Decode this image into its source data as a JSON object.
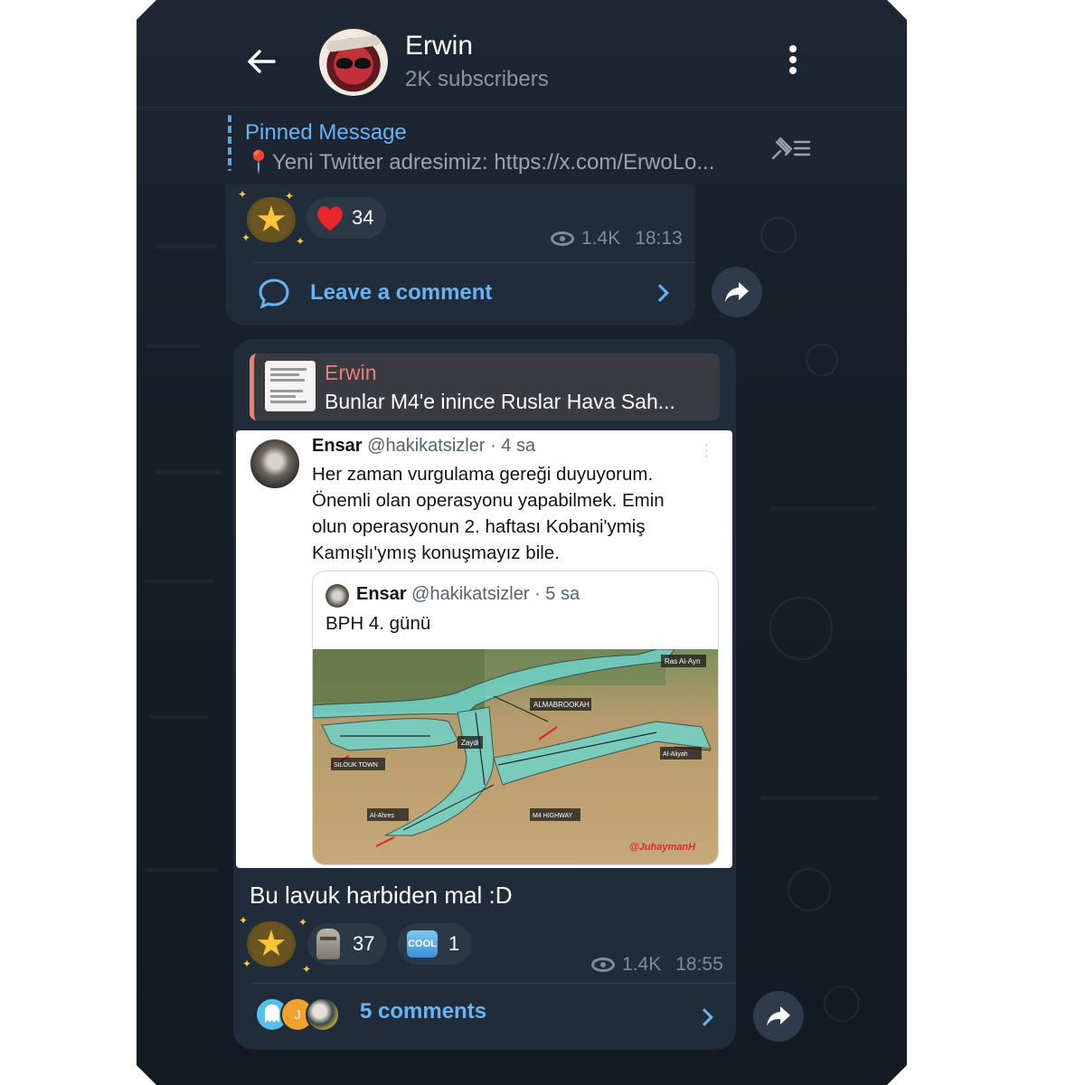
{
  "header": {
    "channel_name": "Erwin",
    "subscribers": "2K subscribers"
  },
  "pinned": {
    "title": "Pinned Message",
    "text": "📍Yeni Twitter adresimiz:  https://x.com/ErwoLo..."
  },
  "message1": {
    "reactions": [
      {
        "icon": "star-icon",
        "count": ""
      },
      {
        "icon": "heart-icon",
        "count": "34"
      }
    ],
    "views": "1.4K",
    "time": "18:13",
    "comment_label": "Leave a comment"
  },
  "message2": {
    "reply": {
      "author": "Erwin",
      "text": "Bunlar M4'e inince Ruslar Hava Sah..."
    },
    "tweet": {
      "author": "Ensar",
      "handle": "@hakikatsizler",
      "age": "· 4 sa",
      "lines": [
        "Her zaman vurgulama gereği duyuyorum.",
        "Önemli olan operasyonu yapabilmek. Emin",
        "olun operasyonun 2. haftası Kobani'ymiş",
        "Kamışlı'ymış konuşmayız bile."
      ],
      "quote": {
        "author": "Ensar",
        "handle": "@hakikatsizler",
        "age": "· 5 sa",
        "text": "BPH 4. günü",
        "map_labels": {
          "ras": "Ras Al-Ayn",
          "almabrookah": "ALMABROOKAH",
          "zaydi": "Zaydi",
          "silouk": "SILOUK TOWN",
          "ahres": "Al-Ahres",
          "alaliyah": "Al-Aliyah",
          "highway": "M4 HIGHWAY",
          "credit": "@JuhaymanH"
        }
      }
    },
    "caption": "Bu lavuk harbiden mal :D",
    "reactions": [
      {
        "icon": "star-icon",
        "count": ""
      },
      {
        "icon": "moai-icon",
        "count": "37"
      },
      {
        "icon": "cool-icon",
        "label": "COOL",
        "count": "1"
      }
    ],
    "views": "1.4K",
    "time": "18:55",
    "comments_label": "5 comments",
    "commenter_initial": "J"
  }
}
